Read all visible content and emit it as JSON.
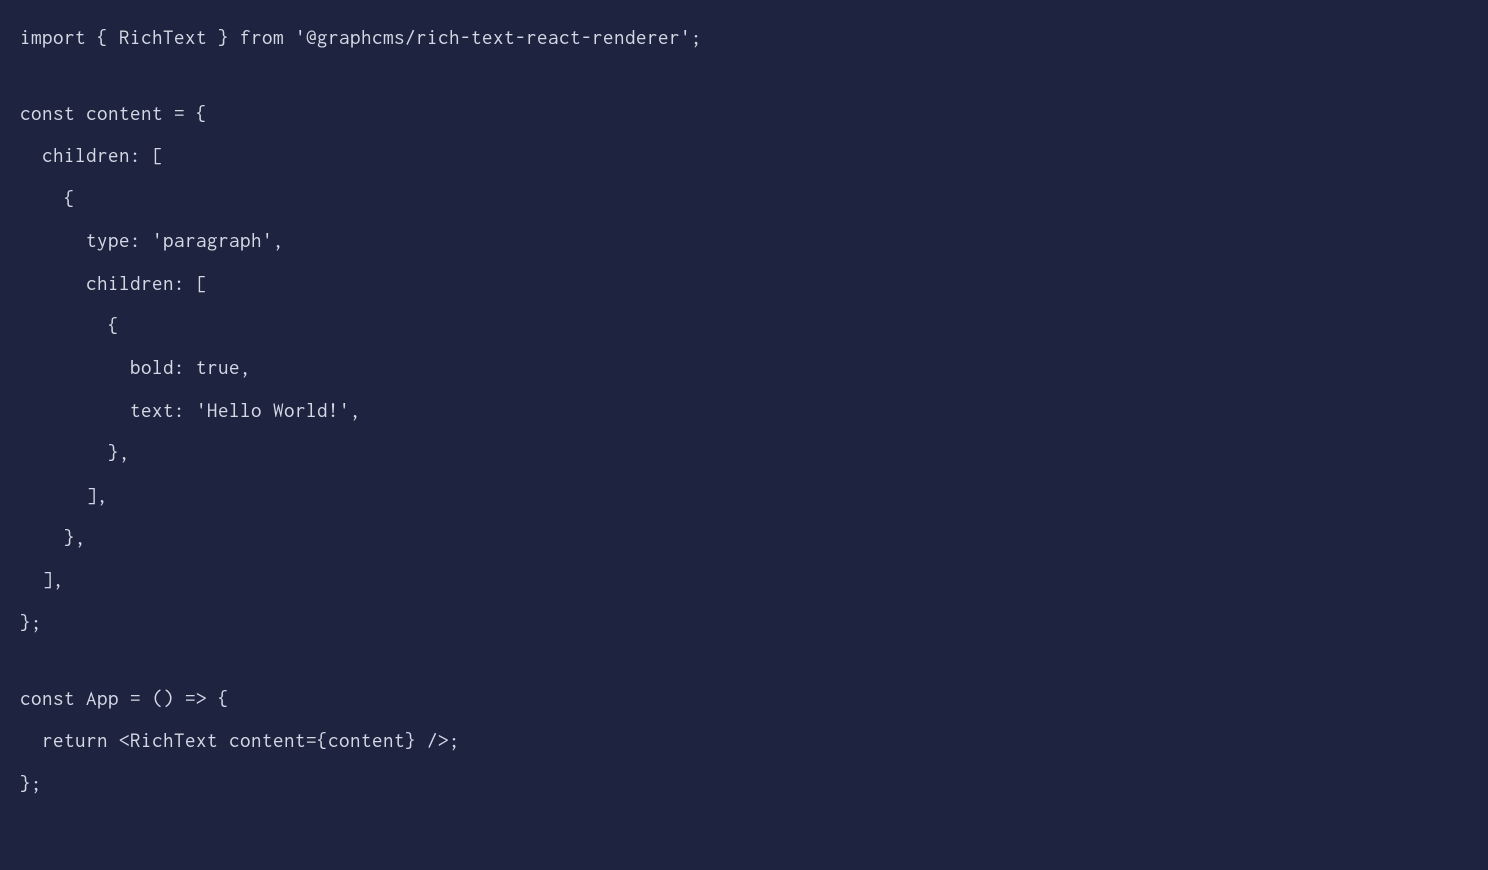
{
  "code": {
    "lines": [
      "import { RichText } from '@graphcms/rich-text-react-renderer';",
      "",
      "const content = {",
      "  children: [",
      "    {",
      "      type: 'paragraph',",
      "      children: [",
      "        {",
      "          bold: true,",
      "          text: 'Hello World!',",
      "        },",
      "      ],",
      "    },",
      "  ],",
      "};",
      "",
      "const App = () => {",
      "  return <RichText content={content} />;",
      "};"
    ]
  }
}
